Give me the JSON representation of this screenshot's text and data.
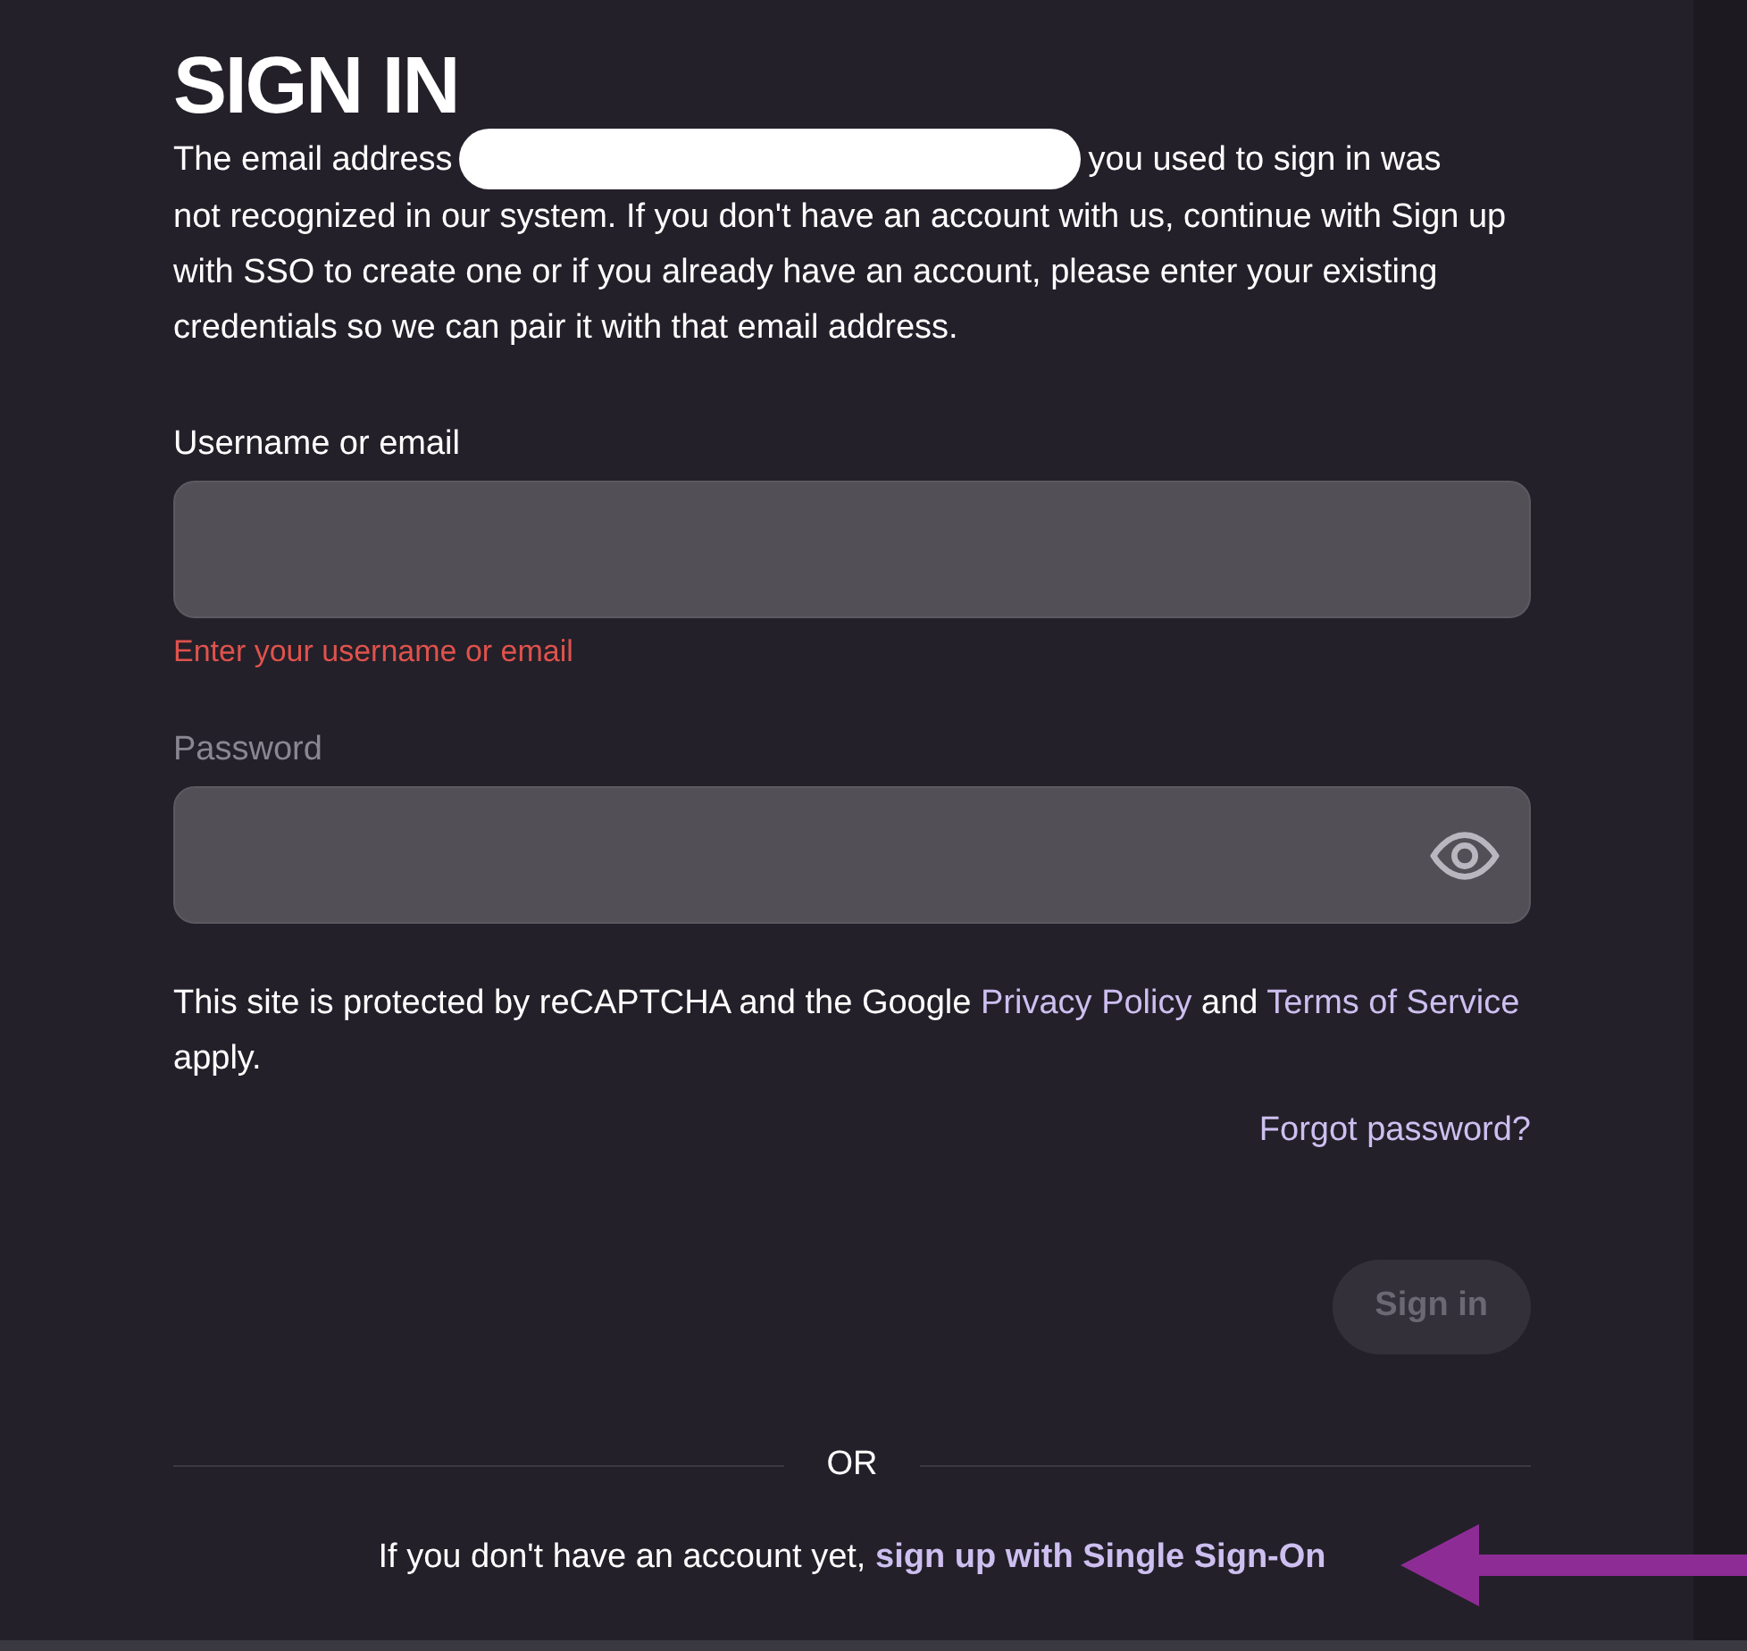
{
  "heading": "SIGN IN",
  "intro": {
    "before": "The email address",
    "after_first_line": "you used to sign in was",
    "rest": "not recognized in our system. If you don't have an account with us, continue with Sign up with SSO to create one or if you already have an account, please enter your existing credentials so we can pair it with that email address."
  },
  "fields": [
    {
      "label": "Username or email",
      "kind": "text",
      "disabled": false,
      "error": "Enter your username or email"
    },
    {
      "label": "Password",
      "kind": "password",
      "disabled": true
    }
  ],
  "recaptcha": {
    "before": "This site is protected by reCAPTCHA and the Google",
    "link_1": "Privacy Policy",
    "middle": "and",
    "link_2": "Terms of Service",
    "after": "apply."
  },
  "forgot_password": "Forgot password?",
  "sign_in_button": {
    "label": "Sign in",
    "disabled": true
  },
  "divider_text": "OR",
  "signup": {
    "prompt": "If you don't have an account yet,",
    "link": "sign up with Single Sign-On"
  }
}
